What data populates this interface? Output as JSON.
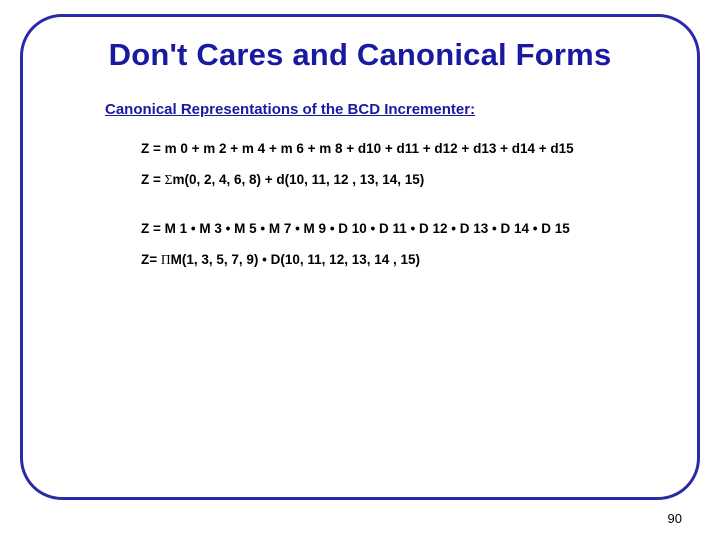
{
  "title": "Don't Cares and Canonical Forms",
  "subtitle": "Canonical Representations of the BCD Incrementer:",
  "equations": {
    "eq1": "Z = m 0 + m 2 + m 4 + m 6 + m 8 + d10 + d11 + d12 + d13 + d14 + d15",
    "eq2_lhs": "Z = ",
    "eq2_sigma": "Σ",
    "eq2_rhs": "m(0, 2, 4, 6, 8) + d(10, 11, 12 , 13, 14, 15)",
    "eq3": "Z = M 1 • M 3 • M 5 • M 7 • M 9 • D 10 • D 11 • D 12 • D 13 • D 14 • D 15",
    "eq4_lhs": "Z= ",
    "eq4_pi": "Π",
    "eq4_rhs": "M(1, 3, 5, 7, 9) • D(10, 11, 12, 13, 14 , 15)"
  },
  "page_number": "90"
}
